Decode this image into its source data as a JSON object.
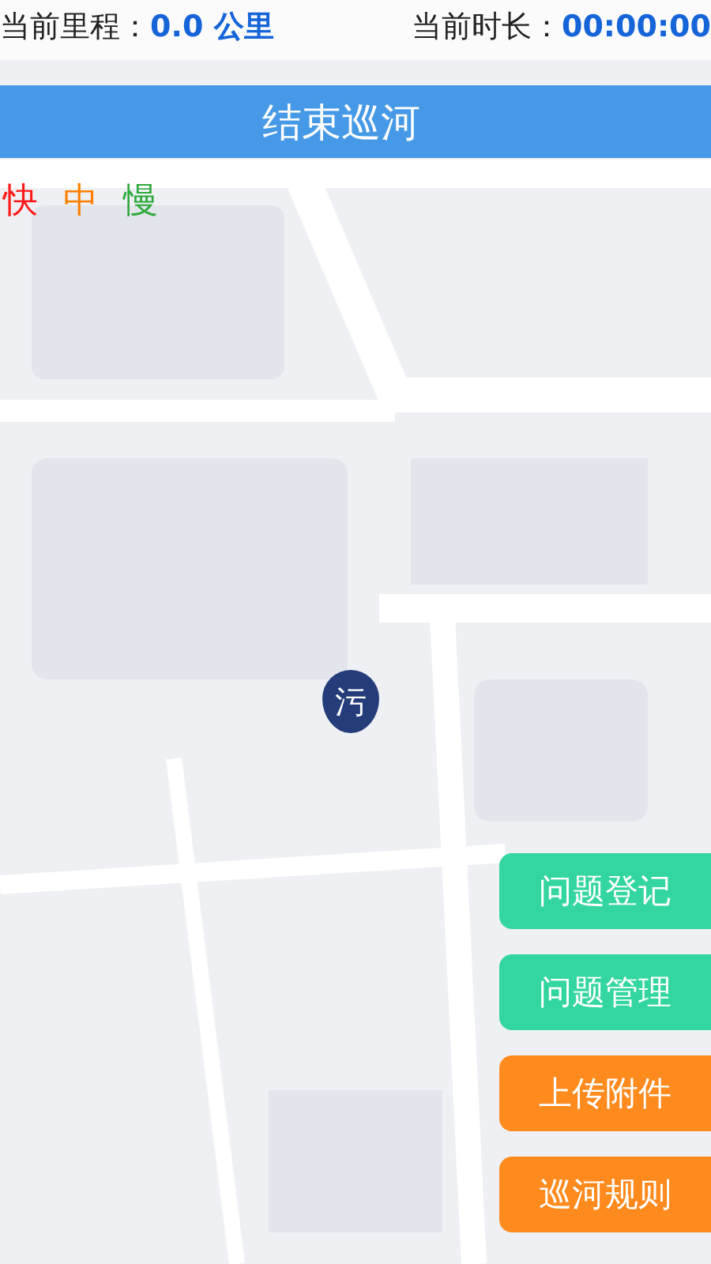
{
  "stats": [
    {
      "label": "当前里程：",
      "value": "0.0 公里"
    },
    {
      "label": "当前时长：",
      "value": "00:00:00"
    }
  ],
  "end_button": {
    "label": "结束巡河"
  },
  "speeds": [
    {
      "label": "快",
      "color": "#ff1a1a"
    },
    {
      "label": "中",
      "color": "#ff8000"
    },
    {
      "label": "慢",
      "color": "#2eaa3c"
    }
  ],
  "marker": {
    "label": "污"
  },
  "actions": [
    {
      "label": "问题登记",
      "color": "#33d6a0"
    },
    {
      "label": "问题管理",
      "color": "#33d6a0"
    },
    {
      "label": "上传附件",
      "color": "#ff8a1e"
    },
    {
      "label": "巡河规则",
      "color": "#ff8a1e"
    }
  ]
}
